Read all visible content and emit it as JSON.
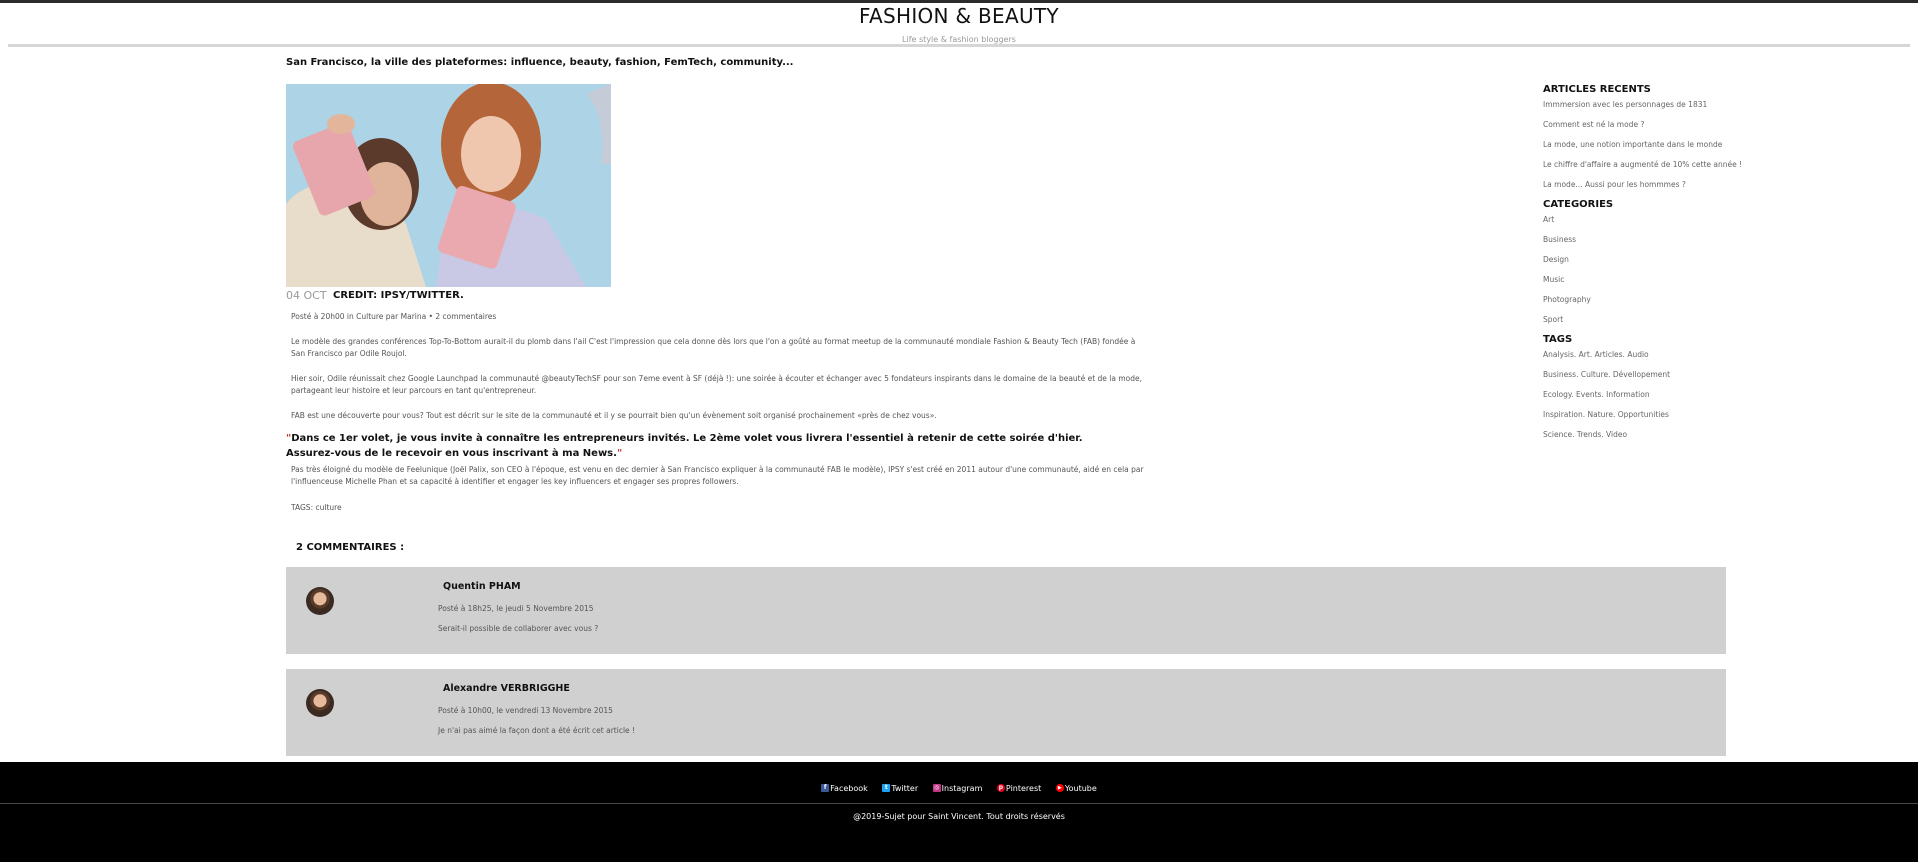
{
  "header": {
    "title": "FASHION & BEAUTY",
    "subtitle": "Life style & fashion bloggers"
  },
  "article": {
    "headline": "San Francisco, la ville des plateformes: influence, beauty, fashion, FemTech, community...",
    "image_alt": "Deux femmes tenant des pochettes roses",
    "date": "04 OCT",
    "credit": "CREDIT: IPSY/TWITTER.",
    "meta": "Posté à 20h00 in Culture par Marina • 2 commentaires",
    "paragraphs": [
      "Le modèle des grandes conférences Top-To-Bottom aurait-il du plomb dans l'ail C'est l'impression que cela donne dès lors que l'on a goûté au format meetup de la communauté mondiale Fashion & Beauty Tech (FAB) fondée à San Francisco par Odile Roujol.",
      "Hier soir, Odile réunissait chez Google Launchpad la communauté @beautyTechSF pour son 7eme event à SF (déjà !): une soirée à écouter et échanger avec 5 fondateurs inspirants dans le domaine de la beauté et de la mode, partageant leur histoire et leur parcours en tant qu'entrepreneur.",
      "FAB est une découverte pour vous? Tout est décrit sur le site de la communauté et il y se pourrait bien qu'un évènement soit organisé prochainement «près de chez vous»."
    ],
    "quote": "Dans ce 1er volet, je vous invite à connaître les entrepreneurs invités. Le 2ème volet vous livrera l'essentiel à retenir de cette soirée d'hier. Assurez-vous de le recevoir en vous inscrivant à ma News.",
    "after_quote": "Pas très éloigné du modèle de Feelunique (Joël Palix, son CEO à l'époque, est venu en dec dernier à San Francisco expliquer à la communauté FAB le modèle), IPSY s'est créé en 2011 autour d'une communauté, aidé en cela par l'influenceuse Michelle Phan et sa capacité à identifier et engager les key influencers et engager ses propres followers.",
    "tags": "TAGS: culture"
  },
  "comments": {
    "title": "2 COMMENTAIRES :",
    "items": [
      {
        "name": "Quentin PHAM",
        "date": "Posté à 18h25, le jeudi 5 Novembre 2015",
        "text": "Serait-il possible de collaborer avec vous ?"
      },
      {
        "name": "Alexandre VERBRIGGHE",
        "date": "Posté à 10h00, le vendredi 13 Novembre 2015",
        "text": "Je n'ai pas aimé la façon dont a été écrit cet article !"
      }
    ]
  },
  "sidebar": {
    "recent_title": "ARTICLES RECENTS",
    "recent": [
      "Immmersion avec les personnages de 1831",
      "Comment est né la mode ?",
      "La mode, une notion importante dans le monde",
      "Le chiffre d'affaire a augmenté de 10% cette année !",
      "La mode... Aussi pour les hommmes ?"
    ],
    "categories_title": "CATEGORIES",
    "categories": [
      "Art",
      "Business",
      "Design",
      "Music",
      "Photography",
      "Sport"
    ],
    "tags_title": "TAGS",
    "tags": [
      "Analysis. Art. Articles. Audio",
      "Business. Culture. Dévellopement",
      "Ecology. Events. Information",
      "Inspiration. Nature. Opportunities",
      "Science. Trends. Video"
    ]
  },
  "footer": {
    "social": [
      {
        "label": "Facebook",
        "icon": "facebook-icon",
        "color": "#3b5998",
        "glyph": "f"
      },
      {
        "label": "Twitter",
        "icon": "twitter-icon",
        "color": "#1da1f2",
        "glyph": "t"
      },
      {
        "label": "Instagram",
        "icon": "instagram-icon",
        "color": "#c13584",
        "glyph": "◎"
      },
      {
        "label": "Pinterest",
        "icon": "pinterest-icon",
        "color": "#e60023",
        "glyph": "p"
      },
      {
        "label": "Youtube",
        "icon": "youtube-icon",
        "color": "#ff0000",
        "glyph": "▶"
      }
    ],
    "copyright": "@2019-Sujet pour Saint Vincent. Tout droits réservés"
  }
}
